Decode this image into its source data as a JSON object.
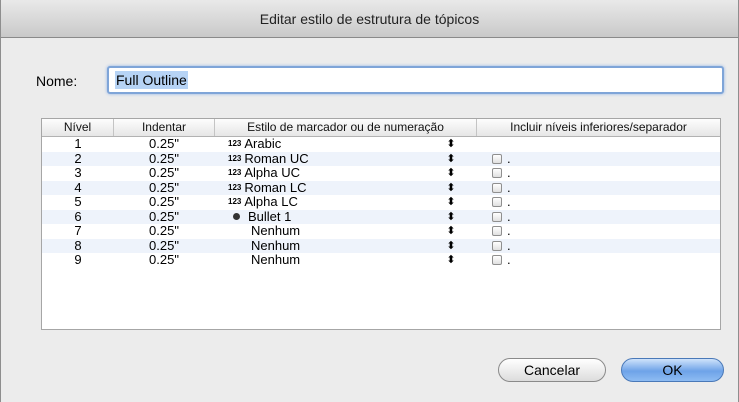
{
  "window": {
    "title": "Editar estilo de estrutura de tópicos"
  },
  "name": {
    "label": "Nome:",
    "value": "Full Outline"
  },
  "table": {
    "headers": [
      "Nível",
      "Indentar",
      "Estilo de marcador ou de numeração",
      "Incluir níveis inferiores/separador"
    ],
    "rows": [
      {
        "level": "1",
        "indent": "0.25\"",
        "style": "Arabic",
        "marker": "123",
        "include": false,
        "separator": ""
      },
      {
        "level": "2",
        "indent": "0.25\"",
        "style": "Roman UC",
        "marker": "123",
        "include": true,
        "separator": "."
      },
      {
        "level": "3",
        "indent": "0.25\"",
        "style": "Alpha UC",
        "marker": "123",
        "include": true,
        "separator": "."
      },
      {
        "level": "4",
        "indent": "0.25\"",
        "style": "Roman LC",
        "marker": "123",
        "include": true,
        "separator": "."
      },
      {
        "level": "5",
        "indent": "0.25\"",
        "style": "Alpha LC",
        "marker": "123",
        "include": true,
        "separator": "."
      },
      {
        "level": "6",
        "indent": "0.25\"",
        "style": "Bullet 1",
        "marker": "bullet",
        "include": true,
        "separator": "."
      },
      {
        "level": "7",
        "indent": "0.25\"",
        "style": "Nenhum",
        "marker": "",
        "include": true,
        "separator": "."
      },
      {
        "level": "8",
        "indent": "0.25\"",
        "style": "Nenhum",
        "marker": "",
        "include": true,
        "separator": "."
      },
      {
        "level": "9",
        "indent": "0.25\"",
        "style": "Nenhum",
        "marker": "",
        "include": true,
        "separator": "."
      }
    ]
  },
  "buttons": {
    "cancel": "Cancelar",
    "ok": "OK"
  },
  "icons": {
    "popup_arrows": "updown-arrows-icon",
    "bullet": "bullet-icon",
    "checkbox": "checkbox-icon"
  }
}
